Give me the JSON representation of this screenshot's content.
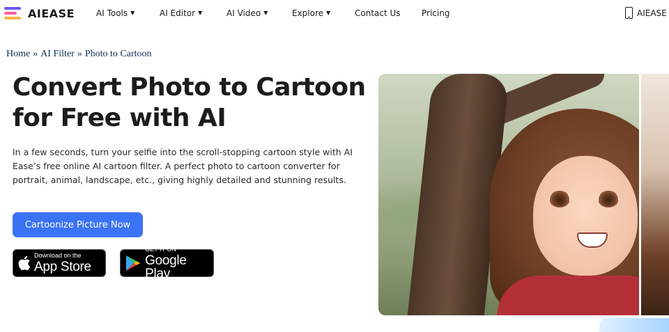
{
  "nav": {
    "logo_text": "AIEASE",
    "items": [
      {
        "label": "AI Tools",
        "has_dropdown": true
      },
      {
        "label": "AI Editor",
        "has_dropdown": true
      },
      {
        "label": "AI Video",
        "has_dropdown": true
      },
      {
        "label": "Explore",
        "has_dropdown": true
      },
      {
        "label": "Contact Us",
        "has_dropdown": false
      },
      {
        "label": "Pricing",
        "has_dropdown": false
      }
    ],
    "app_label": "AIEASE",
    "chevron_icon": "chevron-down-icon",
    "phone_icon": "phone-icon"
  },
  "breadcrumb": {
    "items": [
      "Home",
      "AI Filter",
      "Photo to Cartoon"
    ],
    "separator": "»"
  },
  "hero": {
    "title_line1": "Convert Photo to Cartoon",
    "title_line2": "for Free with AI",
    "description": "In a few seconds, turn your selfie into the scroll-stopping cartoon style with AI Ease’s free online AI cartoon filter. A perfect photo to cartoon converter for portrait, animal, landscape, etc., giving highly detailed and stunning results.",
    "cta_label": "Cartoonize Picture Now",
    "accent_color": "#3b73f5"
  },
  "stores": {
    "apple": {
      "small": "Download on the",
      "big": "App Store",
      "icon": "apple-icon"
    },
    "google": {
      "small": "GET IT ON",
      "big": "Google Play",
      "icon": "google-play-icon"
    }
  }
}
